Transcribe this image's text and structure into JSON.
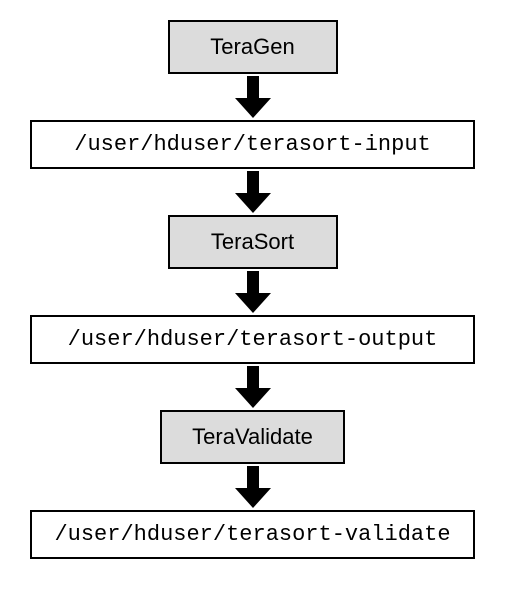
{
  "steps": {
    "teragen": "TeraGen",
    "terasort": "TeraSort",
    "teravalidate": "TeraValidate"
  },
  "paths": {
    "input": "/user/hduser/terasort-input",
    "output": "/user/hduser/terasort-output",
    "validate": "/user/hduser/terasort-validate"
  }
}
